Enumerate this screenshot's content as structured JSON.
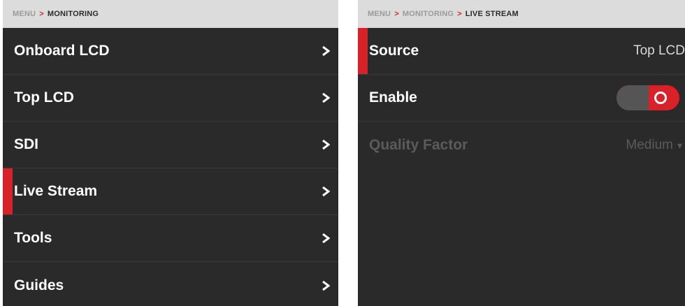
{
  "colors": {
    "accent": "#d9212a",
    "panel_bg": "#2a2a2a",
    "breadcrumb_bg": "#dcdcdc"
  },
  "left_panel": {
    "breadcrumb": {
      "parent": "MENU",
      "separator": ">",
      "current": "MONITORING"
    },
    "items": [
      {
        "label": "Onboard LCD",
        "icon": "chevron-right-icon"
      },
      {
        "label": "Top LCD",
        "icon": "chevron-right-icon"
      },
      {
        "label": "SDI",
        "icon": "chevron-right-icon"
      },
      {
        "label": "Live Stream",
        "icon": "chevron-right-icon",
        "selected": true
      },
      {
        "label": "Tools",
        "icon": "chevron-right-icon"
      },
      {
        "label": "Guides",
        "icon": "chevron-right-icon"
      }
    ]
  },
  "right_panel": {
    "breadcrumb": {
      "root": "MENU",
      "parent": "MONITORING",
      "separator": ">",
      "current": "LIVE STREAM"
    },
    "rows": {
      "source": {
        "label": "Source",
        "value": "Top LCD",
        "selected": true
      },
      "enable": {
        "label": "Enable",
        "toggle_on": true
      },
      "quality_factor": {
        "label": "Quality Factor",
        "value": "Medium",
        "caret": "▾",
        "disabled": true
      }
    }
  }
}
